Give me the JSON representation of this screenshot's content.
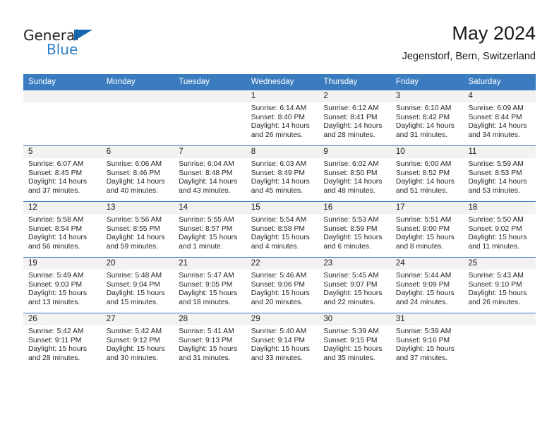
{
  "brand": {
    "name_part1": "General",
    "name_part2": "Blue",
    "triangle_color": "#1565b0",
    "blue_color": "#2a7fc9"
  },
  "header": {
    "title": "May 2024",
    "subtitle": "Jegenstorf, Bern, Switzerland"
  },
  "theme": {
    "header_row_bg": "#3a7cbf",
    "daynum_strip_bg": "#f2f2f2",
    "grid_line": "#3a7cbf",
    "text": "#262626"
  },
  "weekday_headers": [
    "Sunday",
    "Monday",
    "Tuesday",
    "Wednesday",
    "Thursday",
    "Friday",
    "Saturday"
  ],
  "labels": {
    "sunrise_prefix": "Sunrise:",
    "sunset_prefix": "Sunset:",
    "daylight_prefix": "Daylight:"
  },
  "weeks": [
    [
      {
        "day": "",
        "empty": true
      },
      {
        "day": "",
        "empty": true
      },
      {
        "day": "",
        "empty": true
      },
      {
        "day": "1",
        "sunrise": "Sunrise: 6:14 AM",
        "sunset": "Sunset: 8:40 PM",
        "daylight_line1": "Daylight: 14 hours",
        "daylight_line2": "and 26 minutes."
      },
      {
        "day": "2",
        "sunrise": "Sunrise: 6:12 AM",
        "sunset": "Sunset: 8:41 PM",
        "daylight_line1": "Daylight: 14 hours",
        "daylight_line2": "and 28 minutes."
      },
      {
        "day": "3",
        "sunrise": "Sunrise: 6:10 AM",
        "sunset": "Sunset: 8:42 PM",
        "daylight_line1": "Daylight: 14 hours",
        "daylight_line2": "and 31 minutes."
      },
      {
        "day": "4",
        "sunrise": "Sunrise: 6:09 AM",
        "sunset": "Sunset: 8:44 PM",
        "daylight_line1": "Daylight: 14 hours",
        "daylight_line2": "and 34 minutes."
      }
    ],
    [
      {
        "day": "5",
        "sunrise": "Sunrise: 6:07 AM",
        "sunset": "Sunset: 8:45 PM",
        "daylight_line1": "Daylight: 14 hours",
        "daylight_line2": "and 37 minutes."
      },
      {
        "day": "6",
        "sunrise": "Sunrise: 6:06 AM",
        "sunset": "Sunset: 8:46 PM",
        "daylight_line1": "Daylight: 14 hours",
        "daylight_line2": "and 40 minutes."
      },
      {
        "day": "7",
        "sunrise": "Sunrise: 6:04 AM",
        "sunset": "Sunset: 8:48 PM",
        "daylight_line1": "Daylight: 14 hours",
        "daylight_line2": "and 43 minutes."
      },
      {
        "day": "8",
        "sunrise": "Sunrise: 6:03 AM",
        "sunset": "Sunset: 8:49 PM",
        "daylight_line1": "Daylight: 14 hours",
        "daylight_line2": "and 45 minutes."
      },
      {
        "day": "9",
        "sunrise": "Sunrise: 6:02 AM",
        "sunset": "Sunset: 8:50 PM",
        "daylight_line1": "Daylight: 14 hours",
        "daylight_line2": "and 48 minutes."
      },
      {
        "day": "10",
        "sunrise": "Sunrise: 6:00 AM",
        "sunset": "Sunset: 8:52 PM",
        "daylight_line1": "Daylight: 14 hours",
        "daylight_line2": "and 51 minutes."
      },
      {
        "day": "11",
        "sunrise": "Sunrise: 5:59 AM",
        "sunset": "Sunset: 8:53 PM",
        "daylight_line1": "Daylight: 14 hours",
        "daylight_line2": "and 53 minutes."
      }
    ],
    [
      {
        "day": "12",
        "sunrise": "Sunrise: 5:58 AM",
        "sunset": "Sunset: 8:54 PM",
        "daylight_line1": "Daylight: 14 hours",
        "daylight_line2": "and 56 minutes."
      },
      {
        "day": "13",
        "sunrise": "Sunrise: 5:56 AM",
        "sunset": "Sunset: 8:55 PM",
        "daylight_line1": "Daylight: 14 hours",
        "daylight_line2": "and 59 minutes."
      },
      {
        "day": "14",
        "sunrise": "Sunrise: 5:55 AM",
        "sunset": "Sunset: 8:57 PM",
        "daylight_line1": "Daylight: 15 hours",
        "daylight_line2": "and 1 minute."
      },
      {
        "day": "15",
        "sunrise": "Sunrise: 5:54 AM",
        "sunset": "Sunset: 8:58 PM",
        "daylight_line1": "Daylight: 15 hours",
        "daylight_line2": "and 4 minutes."
      },
      {
        "day": "16",
        "sunrise": "Sunrise: 5:53 AM",
        "sunset": "Sunset: 8:59 PM",
        "daylight_line1": "Daylight: 15 hours",
        "daylight_line2": "and 6 minutes."
      },
      {
        "day": "17",
        "sunrise": "Sunrise: 5:51 AM",
        "sunset": "Sunset: 9:00 PM",
        "daylight_line1": "Daylight: 15 hours",
        "daylight_line2": "and 8 minutes."
      },
      {
        "day": "18",
        "sunrise": "Sunrise: 5:50 AM",
        "sunset": "Sunset: 9:02 PM",
        "daylight_line1": "Daylight: 15 hours",
        "daylight_line2": "and 11 minutes."
      }
    ],
    [
      {
        "day": "19",
        "sunrise": "Sunrise: 5:49 AM",
        "sunset": "Sunset: 9:03 PM",
        "daylight_line1": "Daylight: 15 hours",
        "daylight_line2": "and 13 minutes."
      },
      {
        "day": "20",
        "sunrise": "Sunrise: 5:48 AM",
        "sunset": "Sunset: 9:04 PM",
        "daylight_line1": "Daylight: 15 hours",
        "daylight_line2": "and 15 minutes."
      },
      {
        "day": "21",
        "sunrise": "Sunrise: 5:47 AM",
        "sunset": "Sunset: 9:05 PM",
        "daylight_line1": "Daylight: 15 hours",
        "daylight_line2": "and 18 minutes."
      },
      {
        "day": "22",
        "sunrise": "Sunrise: 5:46 AM",
        "sunset": "Sunset: 9:06 PM",
        "daylight_line1": "Daylight: 15 hours",
        "daylight_line2": "and 20 minutes."
      },
      {
        "day": "23",
        "sunrise": "Sunrise: 5:45 AM",
        "sunset": "Sunset: 9:07 PM",
        "daylight_line1": "Daylight: 15 hours",
        "daylight_line2": "and 22 minutes."
      },
      {
        "day": "24",
        "sunrise": "Sunrise: 5:44 AM",
        "sunset": "Sunset: 9:09 PM",
        "daylight_line1": "Daylight: 15 hours",
        "daylight_line2": "and 24 minutes."
      },
      {
        "day": "25",
        "sunrise": "Sunrise: 5:43 AM",
        "sunset": "Sunset: 9:10 PM",
        "daylight_line1": "Daylight: 15 hours",
        "daylight_line2": "and 26 minutes."
      }
    ],
    [
      {
        "day": "26",
        "sunrise": "Sunrise: 5:42 AM",
        "sunset": "Sunset: 9:11 PM",
        "daylight_line1": "Daylight: 15 hours",
        "daylight_line2": "and 28 minutes."
      },
      {
        "day": "27",
        "sunrise": "Sunrise: 5:42 AM",
        "sunset": "Sunset: 9:12 PM",
        "daylight_line1": "Daylight: 15 hours",
        "daylight_line2": "and 30 minutes."
      },
      {
        "day": "28",
        "sunrise": "Sunrise: 5:41 AM",
        "sunset": "Sunset: 9:13 PM",
        "daylight_line1": "Daylight: 15 hours",
        "daylight_line2": "and 31 minutes."
      },
      {
        "day": "29",
        "sunrise": "Sunrise: 5:40 AM",
        "sunset": "Sunset: 9:14 PM",
        "daylight_line1": "Daylight: 15 hours",
        "daylight_line2": "and 33 minutes."
      },
      {
        "day": "30",
        "sunrise": "Sunrise: 5:39 AM",
        "sunset": "Sunset: 9:15 PM",
        "daylight_line1": "Daylight: 15 hours",
        "daylight_line2": "and 35 minutes."
      },
      {
        "day": "31",
        "sunrise": "Sunrise: 5:39 AM",
        "sunset": "Sunset: 9:16 PM",
        "daylight_line1": "Daylight: 15 hours",
        "daylight_line2": "and 37 minutes."
      },
      {
        "day": "",
        "empty": true
      }
    ]
  ]
}
